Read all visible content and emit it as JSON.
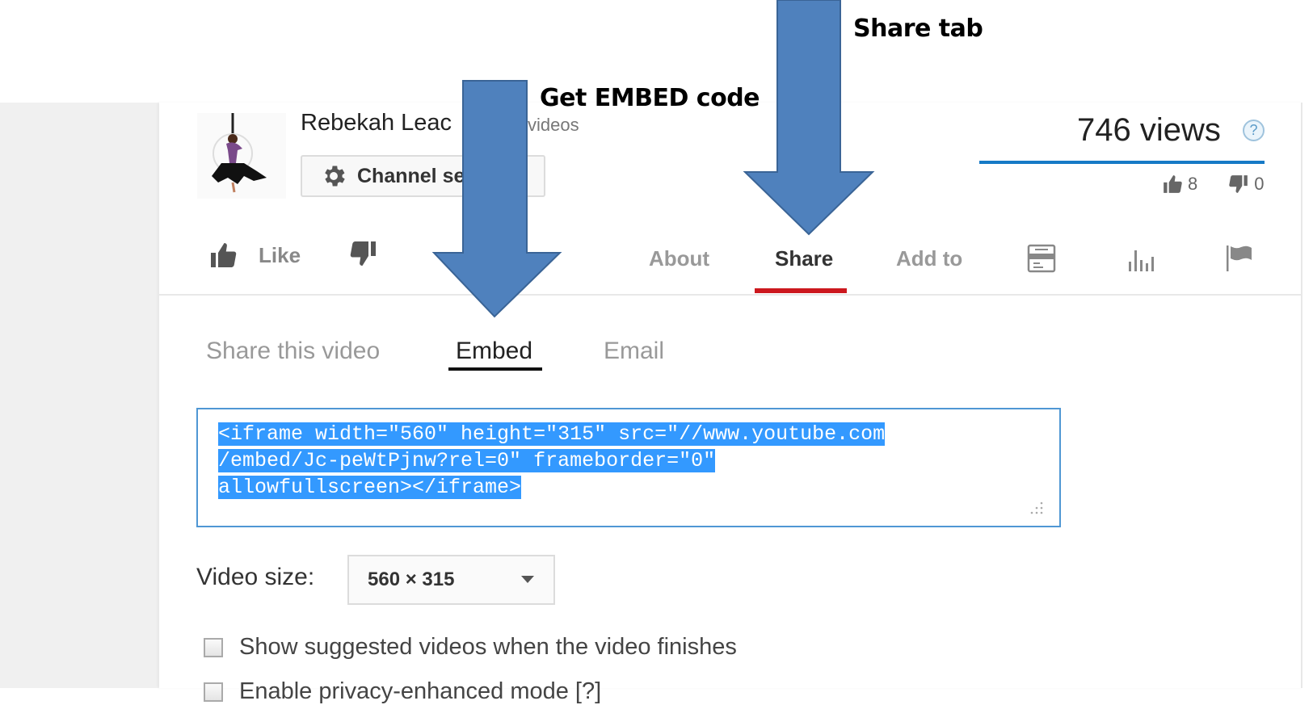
{
  "annotations": {
    "share_tab_label": "Share tab",
    "embed_label": "Get EMBED code",
    "arrow_color": "#4f81bd"
  },
  "channel": {
    "name": "Rebekah Leac",
    "video_count_text": "videos",
    "settings_button": "Channel se"
  },
  "stats": {
    "views": "746 views",
    "help_icon": "?",
    "likes": "8",
    "dislikes": "0",
    "like_ratio": 1.0
  },
  "actions": {
    "like_label": "Like",
    "tabs": [
      {
        "label": "About",
        "active": false
      },
      {
        "label": "Share",
        "active": true
      },
      {
        "label": "Add to",
        "active": false
      }
    ],
    "icon_buttons": [
      "transcript-icon",
      "statistics-icon",
      "flag-icon"
    ],
    "active_color": "#cc181e"
  },
  "share_panel": {
    "sub_tabs": [
      {
        "label": "Share this video",
        "active": false
      },
      {
        "label": "Embed",
        "active": true
      },
      {
        "label": "Email",
        "active": false
      }
    ],
    "embed_code_lines": [
      "<iframe width=\"560\" height=\"315\" src=\"//www.youtube.com",
      "/embed/Jc-peWtPjnw?rel=0\" frameborder=\"0\"",
      "allowfullscreen></iframe>"
    ],
    "video_size_label": "Video size:",
    "video_size_value": "560 × 315",
    "options": [
      {
        "label": "Show suggested videos when the video finishes",
        "checked": false
      },
      {
        "label": "Enable privacy-enhanced mode [?]",
        "checked": false
      }
    ]
  }
}
